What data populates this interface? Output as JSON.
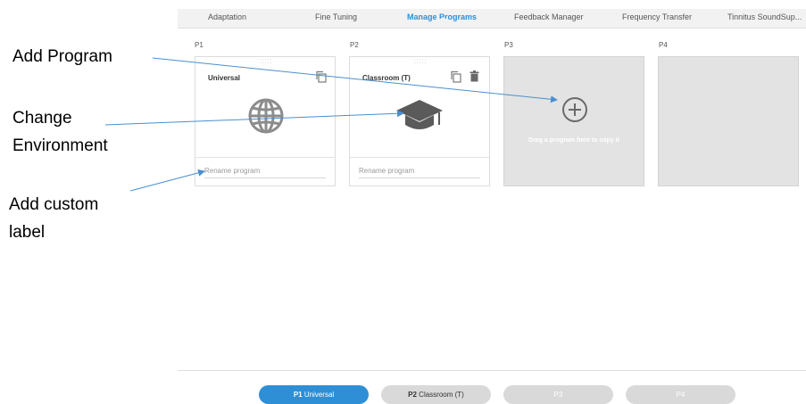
{
  "tabs": [
    {
      "label": "Adaptation"
    },
    {
      "label": "Fine Tuning"
    },
    {
      "label": "Manage Programs"
    },
    {
      "label": "Feedback Manager"
    },
    {
      "label": "Frequency Transfer"
    },
    {
      "label": "Tinnitus SoundSup..."
    }
  ],
  "active_tab": "Manage Programs",
  "slots": [
    {
      "label": "P1",
      "program": "Universal",
      "rename_placeholder": "Rename program",
      "icon": "globe-icon"
    },
    {
      "label": "P2",
      "program": "Classroom (T)",
      "rename_placeholder": "Rename program",
      "icon": "graduation-cap-icon"
    },
    {
      "label": "P3",
      "drop_text": "Drag a program here to copy it",
      "icon": "add-circle-icon"
    },
    {
      "label": "P4"
    }
  ],
  "annotations": {
    "add_program": "Add Program",
    "change_environment_line1": "Change",
    "change_environment_line2": "Environment",
    "add_custom_label_line1": "Add custom",
    "add_custom_label_line2": "label"
  },
  "program_pills": [
    {
      "id": "P1",
      "name": "Universal"
    },
    {
      "id": "P2",
      "name": "Classroom (T)"
    },
    {
      "id": "P3",
      "name": ""
    },
    {
      "id": "P4",
      "name": ""
    }
  ],
  "colors": {
    "accent": "#2e8fd6",
    "annotation_arrow": "#4a8fd0",
    "empty_slot": "#e3e3e3",
    "icon_gray": "#8c8c8c",
    "cap_gray": "#5a5a5a"
  }
}
